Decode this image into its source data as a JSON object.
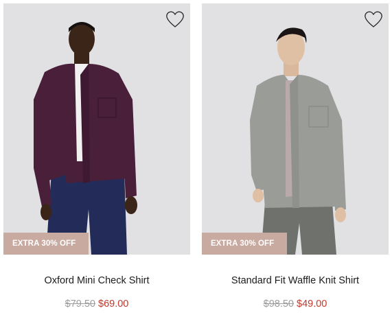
{
  "products": [
    {
      "name": "Oxford Mini Check Shirt",
      "badge": "EXTRA 30% OFF",
      "original_price": "$79.50",
      "sale_price": "$69.00",
      "wishlist_icon": "heart-outline-icon",
      "shirt_color": "#4a1f3a",
      "background_color": "#e1e1e3"
    },
    {
      "name": "Standard Fit Waffle Knit Shirt",
      "badge": "EXTRA 30% OFF",
      "original_price": "$98.50",
      "sale_price": "$49.00",
      "wishlist_icon": "heart-outline-icon",
      "shirt_color": "#9a9c98",
      "background_color": "#e1e1e3"
    }
  ],
  "colors": {
    "badge_bg": "#c9aaa1",
    "sale_price": "#c0392b",
    "original_price": "#9c9c9c"
  }
}
